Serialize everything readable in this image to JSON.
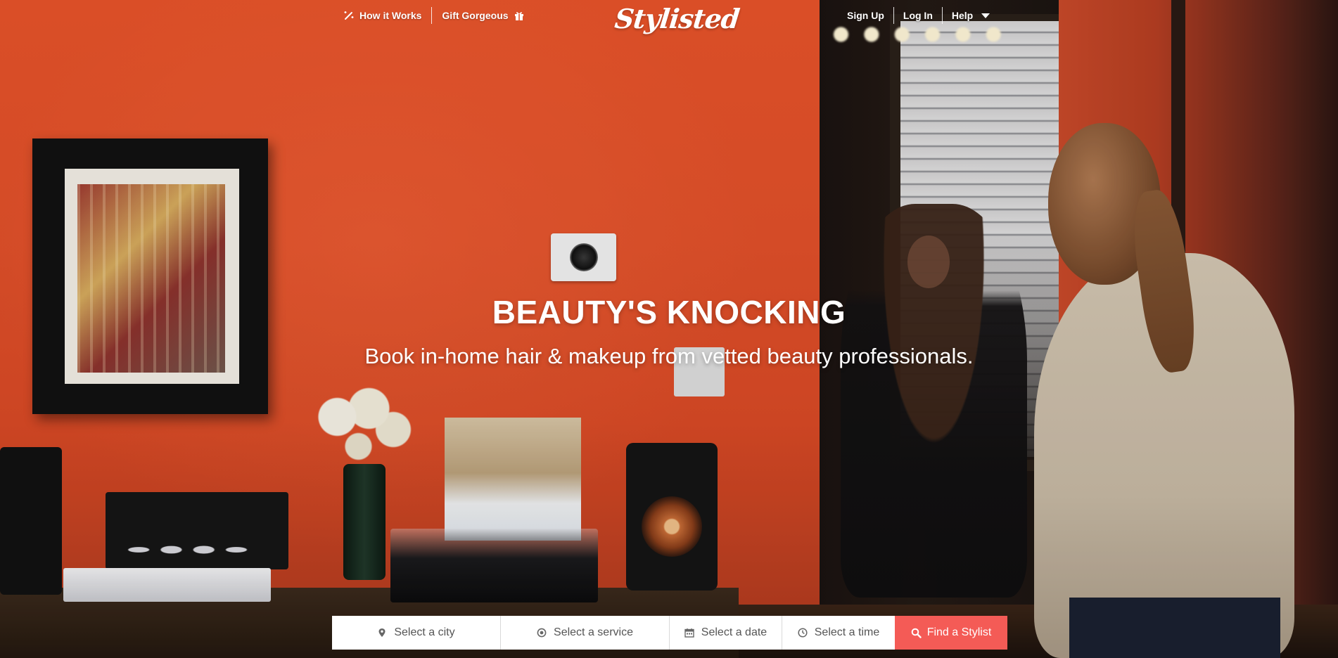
{
  "nav": {
    "how_it_works": "How it Works",
    "gift_gorgeous": "Gift Gorgeous",
    "brand": "Stylisted",
    "sign_up": "Sign Up",
    "log_in": "Log In",
    "help": "Help"
  },
  "hero": {
    "headline": "BEAUTY'S KNOCKING",
    "subheadline": "Book in-home hair & makeup from vetted beauty professionals."
  },
  "search": {
    "city_placeholder": "Select a city",
    "service_placeholder": "Select a service",
    "date_placeholder": "Select a date",
    "time_placeholder": "Select a time",
    "submit_label": "Find a Stylist"
  },
  "icons": {
    "how_it_works": "magic-wand-icon",
    "gift": "gift-icon",
    "help_caret": "caret-down-icon",
    "city": "map-pin-icon",
    "service": "target-icon",
    "date": "calendar-icon",
    "time": "clock-icon",
    "submit": "search-icon"
  },
  "colors": {
    "accent": "#f45b56",
    "wall": "#e5532b",
    "text_light": "#ffffff"
  }
}
